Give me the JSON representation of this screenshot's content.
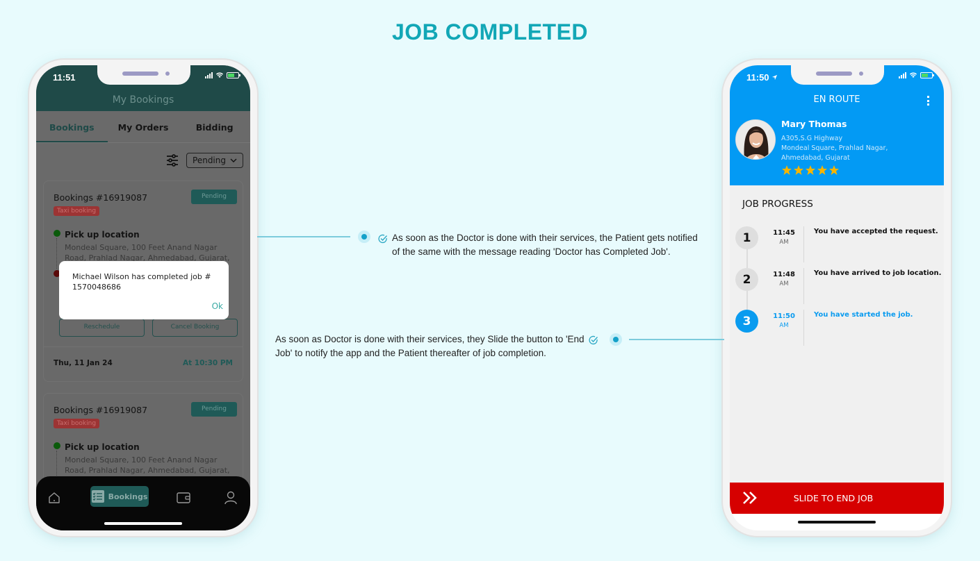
{
  "page": {
    "title": "JOB COMPLETED",
    "accent_color": "#12a7b6"
  },
  "left_phone": {
    "status_time": "11:51",
    "header_title": "My Bookings",
    "tabs": [
      {
        "label": "Bookings",
        "active": true
      },
      {
        "label": "My Orders",
        "active": false
      },
      {
        "label": "Bidding",
        "active": false
      }
    ],
    "filter_icon": "sliders-icon",
    "status_filter": "Pending",
    "bookings": [
      {
        "title": "Bookings #16919087",
        "status": "Pending",
        "type": "Taxi booking",
        "pickup_label": "Pick up location",
        "pickup_address": "Mondeal Square, 100 Feet Anand Nagar Road, Prahlad Nagar, Ahmedabad, Gujarat, India",
        "actions": [
          "Reschedule",
          "Cancel Booking"
        ],
        "date": "Thu, 11 Jan 24",
        "time": "At 10:30 PM"
      },
      {
        "title": "Bookings #16919087",
        "status": "Pending",
        "type": "Taxi booking",
        "pickup_label": "Pick up location",
        "pickup_address": "Mondeal Square, 100 Feet Anand Nagar Road, Prahlad Nagar, Ahmedabad, Gujarat, India"
      }
    ],
    "dialog": {
      "message": "Michael Wilson has completed job # 1570048686",
      "ok_label": "Ok"
    },
    "bottom_nav": [
      {
        "icon": "home-icon",
        "label": ""
      },
      {
        "icon": "checklist-icon",
        "label": "Bookings",
        "active": true
      },
      {
        "icon": "wallet-icon",
        "label": ""
      },
      {
        "icon": "profile-icon",
        "label": ""
      }
    ]
  },
  "right_phone": {
    "status_time": "11:50",
    "header_title": "EN ROUTE",
    "customer": {
      "name": "Mary Thomas",
      "address_line1": "A305,S.G Highway",
      "address_line2": "Mondeal Square, Prahlad Nagar,",
      "address_line3": "Ahmedabad, Gujarat",
      "rating": 5,
      "rating_max": 5
    },
    "job_progress_title": "JOB PROGRESS",
    "steps": [
      {
        "number": "1",
        "time": "11:45",
        "ampm": "AM",
        "text": "You have accepted the request.",
        "active": false
      },
      {
        "number": "2",
        "time": "11:48",
        "ampm": "AM",
        "text": "You have arrived to job location.",
        "active": false
      },
      {
        "number": "3",
        "time": "11:50",
        "ampm": "AM",
        "text": "You have started the job.",
        "active": true
      }
    ],
    "slide_button_label": "SLIDE TO END JOB",
    "colors": {
      "header": "#039af4",
      "slide": "#d60000"
    }
  },
  "annotations": [
    {
      "text": "As soon as the Doctor is done with their services, the Patient gets notified of the same with the message reading 'Doctor has Completed Job'."
    },
    {
      "text": "As soon as Doctor is done with their services, they Slide the button to 'End Job' to notify the app and the Patient thereafter of job completion."
    }
  ]
}
